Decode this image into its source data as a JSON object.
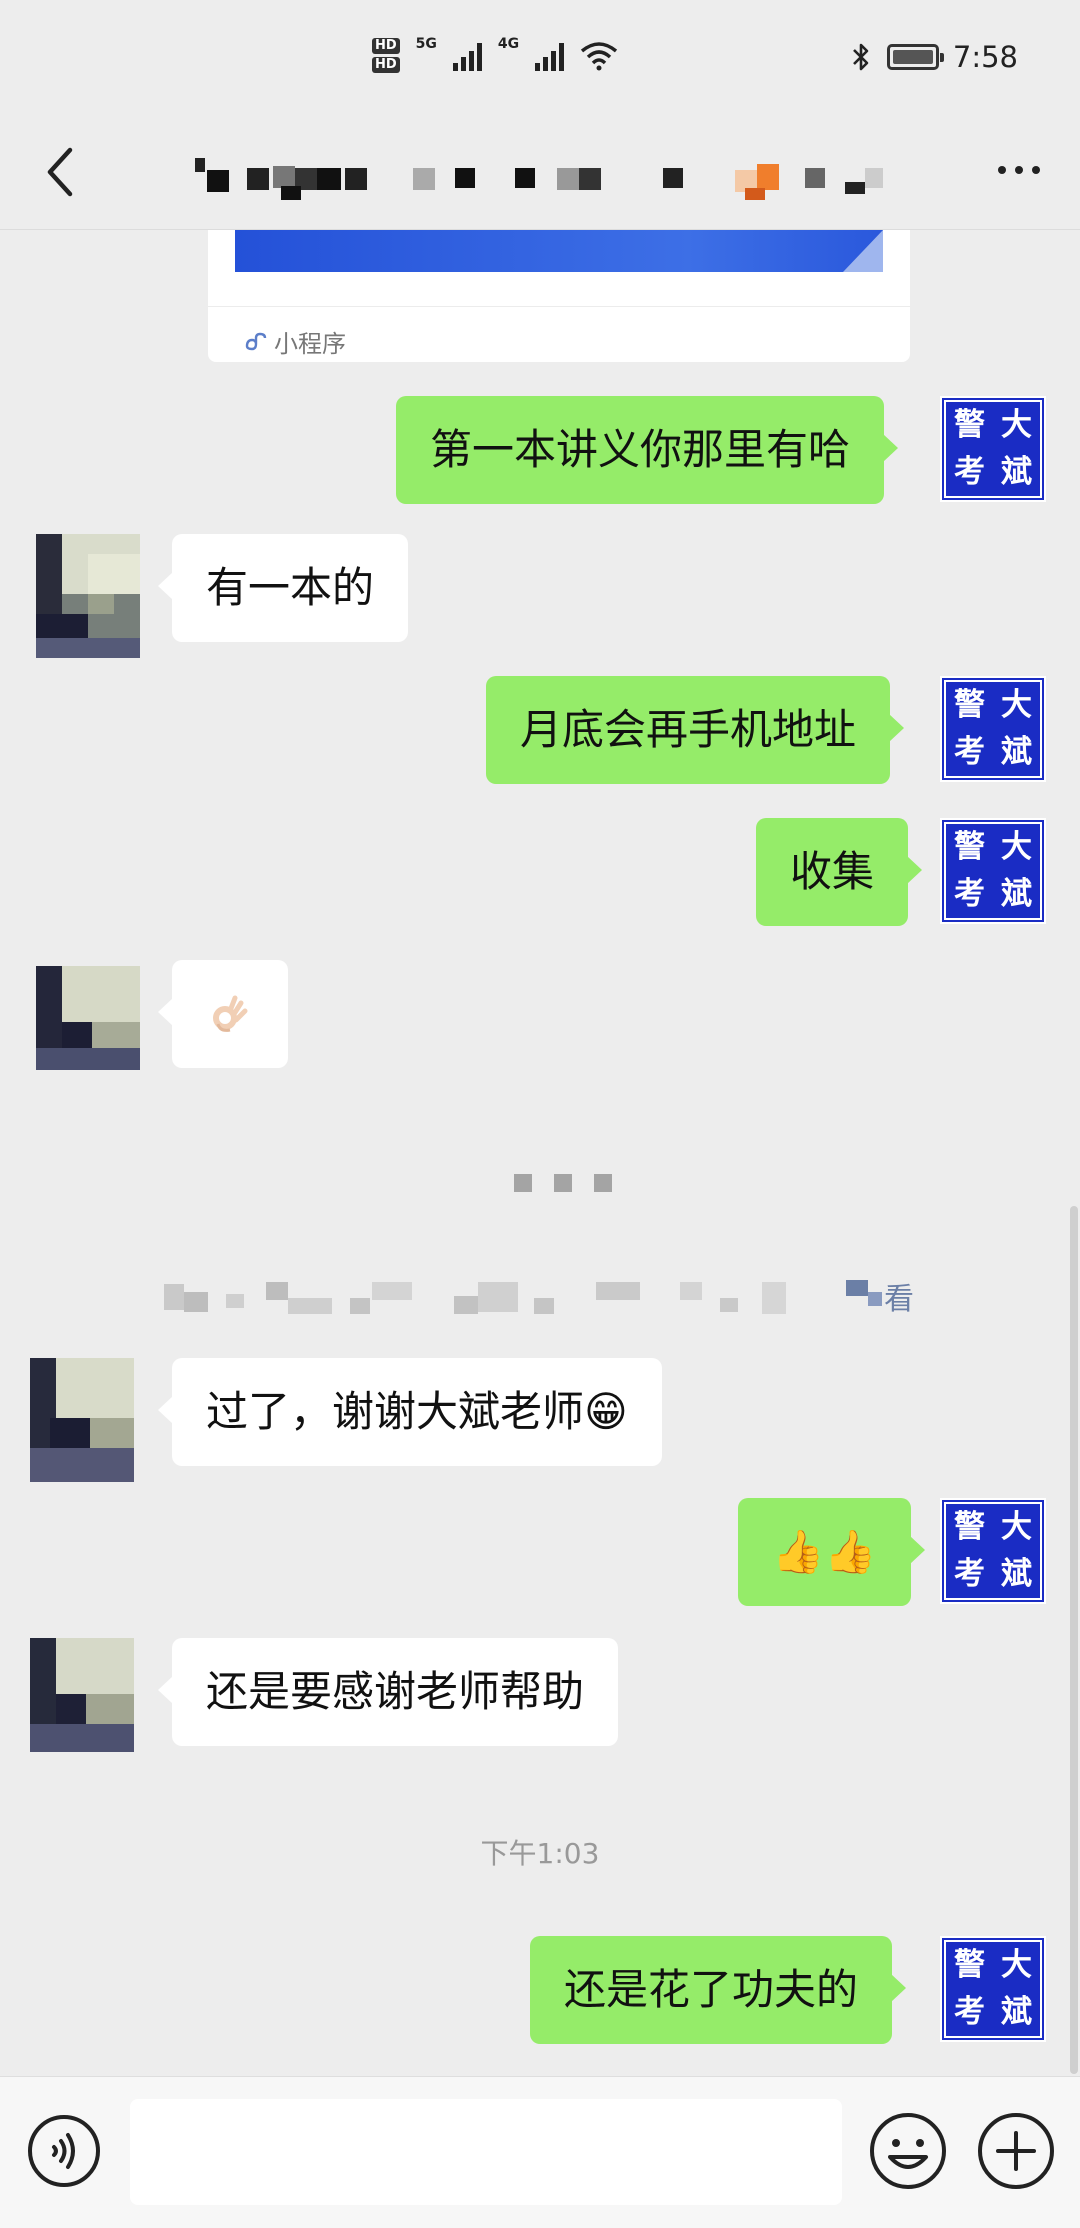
{
  "status_bar": {
    "sim1_label": "HD",
    "sim2_label": "HD",
    "net1": "5G",
    "net2": "4G",
    "time": "7:58",
    "icons": [
      "signal-icon",
      "wifi-icon",
      "bluetooth-icon",
      "battery-icon"
    ]
  },
  "header": {
    "back_icon": "chevron-left-icon",
    "title": "",
    "more_icon": "more-dots-icon"
  },
  "mini_program": {
    "label": "小程序",
    "icon": "mini-program-icon"
  },
  "my_avatar": {
    "chars": [
      "警",
      "大",
      "考",
      "斌"
    ]
  },
  "messages": [
    {
      "side": "me",
      "text": "第一本讲义你那里有哈"
    },
    {
      "side": "them",
      "text": "有一本的"
    },
    {
      "side": "me",
      "text": "月底会再手机地址"
    },
    {
      "side": "me",
      "text": "收集"
    },
    {
      "side": "them",
      "text": "",
      "emoji": "ok-hand-emoji"
    },
    {
      "side": "them",
      "text": "过了，谢谢大斌老师😁"
    },
    {
      "side": "me",
      "text": "👍👍"
    },
    {
      "side": "them",
      "text": "还是要感谢老师帮助"
    },
    {
      "side": "me",
      "text": "还是花了功夫的"
    }
  ],
  "system_notice": {
    "tail_text": "看"
  },
  "time_separator": "下午1:03",
  "input_bar": {
    "placeholder": "",
    "voice_icon": "voice-icon",
    "emoji_icon": "emoji-icon",
    "plus_icon": "plus-icon"
  },
  "colors": {
    "my_bubble": "#95ec69",
    "their_bubble": "#ffffff",
    "background": "#ededed",
    "avatar_blue": "#1a2cc4"
  }
}
